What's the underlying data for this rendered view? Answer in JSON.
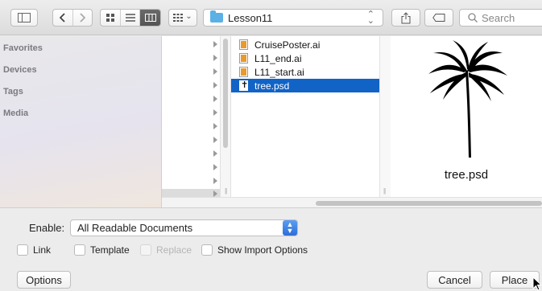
{
  "toolbar": {
    "sidebar_toggle_icon": "sidebar-icon",
    "back_icon": "chevron-left-icon",
    "forward_icon": "chevron-right-icon",
    "view_modes": [
      "icon-view-icon",
      "list-view-icon",
      "column-view-icon"
    ],
    "group_icon": "grid-group-icon",
    "group_caret": "⌄",
    "path_label": "Lesson11",
    "share_icon": "share-icon",
    "tag_icon": "tag-icon",
    "search_placeholder": "Search"
  },
  "sidebar": {
    "items": [
      {
        "label": "Favorites"
      },
      {
        "label": "Devices"
      },
      {
        "label": "Tags"
      },
      {
        "label": "Media"
      }
    ]
  },
  "files": [
    {
      "name": "CruisePoster.ai",
      "icon": "ai-file-icon",
      "selected": false
    },
    {
      "name": "L11_end.ai",
      "icon": "ai-file-icon",
      "selected": false
    },
    {
      "name": "L11_start.ai",
      "icon": "ai-file-icon",
      "selected": false
    },
    {
      "name": "tree.psd",
      "icon": "psd-file-icon",
      "selected": true
    }
  ],
  "preview": {
    "filename": "tree.psd",
    "image": "palm-tree-silhouette"
  },
  "options": {
    "enable_label": "Enable:",
    "enable_value": "All Readable Documents",
    "checkboxes": [
      {
        "label": "Link",
        "enabled": true,
        "checked": false
      },
      {
        "label": "Template",
        "enabled": true,
        "checked": false
      },
      {
        "label": "Replace",
        "enabled": false,
        "checked": false
      },
      {
        "label": "Show Import Options",
        "enabled": true,
        "checked": false
      }
    ]
  },
  "buttons": {
    "options": "Options",
    "cancel": "Cancel",
    "place": "Place"
  },
  "colors": {
    "selection": "#1163c6",
    "accent_popup": "#2c6ed8",
    "folder": "#5bb0e6"
  }
}
